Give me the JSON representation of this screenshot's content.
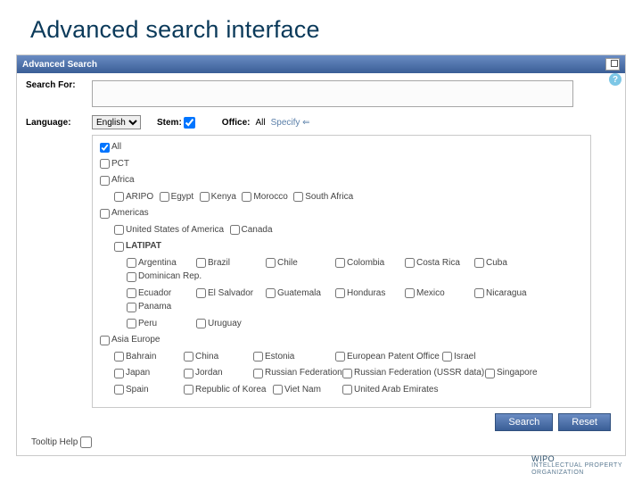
{
  "page": {
    "title": "Advanced search interface"
  },
  "panel": {
    "header": "Advanced Search"
  },
  "labels": {
    "search_for": "Search For:",
    "language": "Language:",
    "stem": "Stem:",
    "office": "Office:",
    "specify": "Specify ⇐",
    "tooltip": "Tooltip Help"
  },
  "language": {
    "selected": "English",
    "stem_checked": true
  },
  "office_summary": "All",
  "offices": {
    "all": "All",
    "all_checked": true,
    "pct": "PCT",
    "africa": "Africa",
    "africa_items": [
      "ARIPO",
      "Egypt",
      "Kenya",
      "Morocco",
      "South Africa"
    ],
    "americas": "Americas",
    "americas_row1": [
      "United States of America",
      "Canada"
    ],
    "latipat": "LATIPAT",
    "latipat_row1": [
      "Argentina",
      "Brazil",
      "Chile",
      "Colombia",
      "Costa Rica",
      "Cuba",
      "Dominican Rep."
    ],
    "latipat_row2": [
      "Ecuador",
      "El Salvador",
      "Guatemala",
      "Honduras",
      "Mexico",
      "Nicaragua",
      "Panama"
    ],
    "latipat_row3": [
      "Peru",
      "Uruguay"
    ],
    "asiaeu": "Asia Europe",
    "asiaeu_row1": [
      "Bahrain",
      "China",
      "Estonia",
      "European Patent Office",
      "Israel"
    ],
    "asiaeu_row2": [
      "Japan",
      "Jordan",
      "Russian Federation",
      "Russian Federation (USSR data)",
      "Singapore"
    ],
    "asiaeu_row3": [
      "Spain",
      "Republic of Korea",
      "Viet Nam",
      "United Arab Emirates"
    ]
  },
  "buttons": {
    "search": "Search",
    "reset": "Reset"
  },
  "footer": {
    "l1": "WIPO",
    "l2": "INTELLECTUAL PROPERTY",
    "l3": "ORGANIZATION"
  }
}
